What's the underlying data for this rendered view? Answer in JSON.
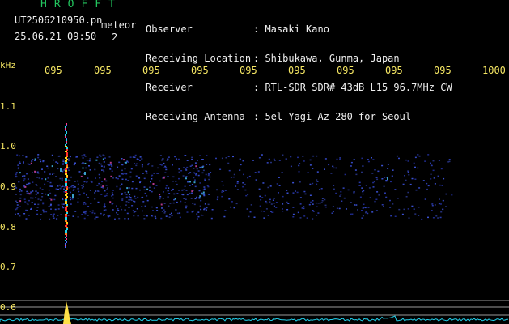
{
  "header": {
    "logo": "HROFFT",
    "file_name": "UT2506210950.pn",
    "datetime": "25.06.21 09:50",
    "meteor_label": "meteor",
    "meteor_count": "2"
  },
  "info": [
    {
      "label": "Observer",
      "value": ": Masaki Kano"
    },
    {
      "label": "Receiving Location",
      "value": ": Shibukawa, Gunma, Japan"
    },
    {
      "label": "Receiver",
      "value": ": RTL-SDR SDR# 43dB L15 96.7MHz CW"
    },
    {
      "label": "Receiving Antenna",
      "value": ": 5el Yagi Az 280 for Seoul"
    }
  ],
  "axis": {
    "y_unit": "kHz",
    "y_ticks": [
      "1.1",
      "1.0",
      "0.9",
      "0.8",
      "0.7",
      "0.6"
    ],
    "x_ticks": [
      "095",
      "095",
      "095",
      "095",
      "095",
      "095",
      "095",
      "095",
      "095",
      "1000"
    ]
  },
  "colors": {
    "background": "#000000",
    "header_green": "#22c55e",
    "axis_yellow": "#f5e663",
    "meteor_trace": "#ff3b3b",
    "noise_blue": "#2a3aa8",
    "spectrum_cyan": "#22d3ee",
    "spectrum_peak": "#fde047"
  }
}
